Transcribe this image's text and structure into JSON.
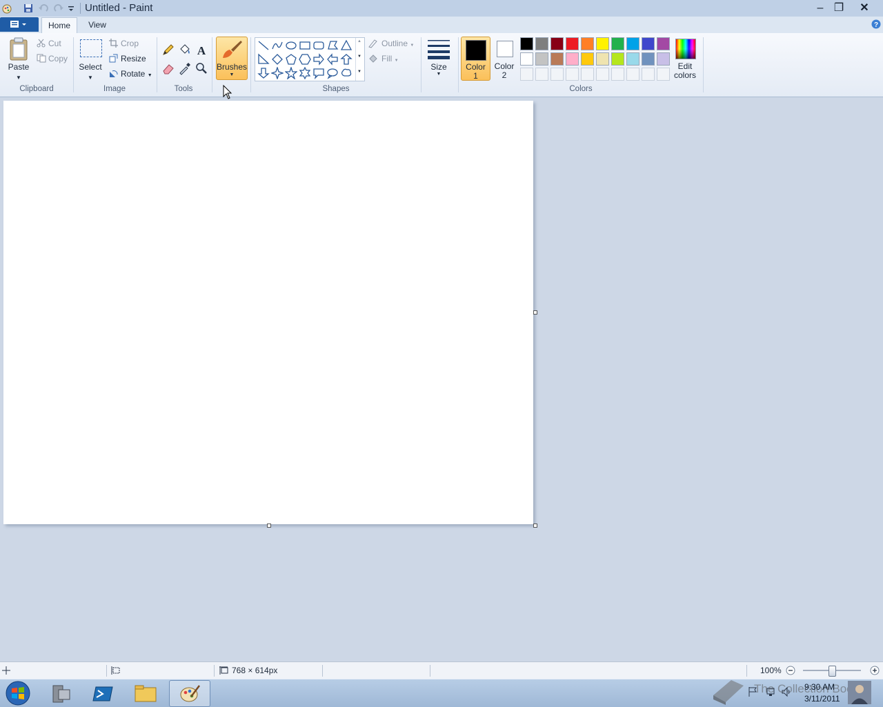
{
  "window": {
    "title": "Untitled - Paint"
  },
  "tabs": {
    "home": "Home",
    "view": "View"
  },
  "clipboard": {
    "paste": "Paste",
    "cut": "Cut",
    "copy": "Copy",
    "group": "Clipboard"
  },
  "image": {
    "select": "Select",
    "crop": "Crop",
    "resize": "Resize",
    "rotate": "Rotate",
    "group": "Image"
  },
  "tools": {
    "group": "Tools"
  },
  "brushes": {
    "label": "Brushes"
  },
  "shapes": {
    "group": "Shapes",
    "outline": "Outline",
    "fill": "Fill"
  },
  "size": {
    "label": "Size"
  },
  "colors": {
    "group": "Colors",
    "color1_line1": "Color",
    "color1_line2": "1",
    "color2_line1": "Color",
    "color2_line2": "2",
    "edit_line1": "Edit",
    "edit_line2": "colors",
    "color1_value": "#000000",
    "color2_value": "#ffffff",
    "palette_row1": [
      "#000000",
      "#7f7f7f",
      "#880015",
      "#ed1c24",
      "#ff7f27",
      "#fff200",
      "#22b14c",
      "#00a2e8",
      "#3f48cc",
      "#a349a4"
    ],
    "palette_row2": [
      "#ffffff",
      "#c3c3c3",
      "#b97a57",
      "#ffaec9",
      "#ffc90e",
      "#efe4b0",
      "#b5e61d",
      "#99d9ea",
      "#7092be",
      "#c8bfe7"
    ]
  },
  "status": {
    "canvas_size": "768 × 614px",
    "zoom": "100%"
  },
  "taskbar": {
    "time": "9:30 AM",
    "date": "3/11/2011",
    "watermark": "The Collection Book"
  }
}
